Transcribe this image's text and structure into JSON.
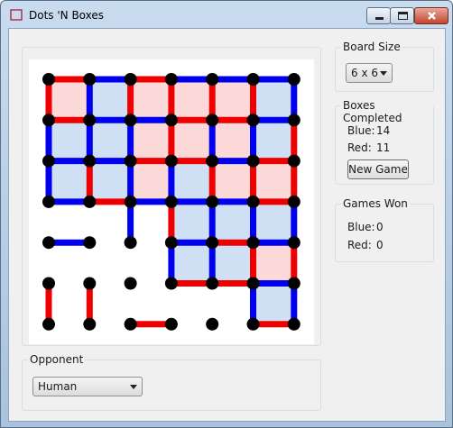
{
  "window": {
    "title": "Dots 'N Boxes"
  },
  "controls": {
    "minimize": "minimize",
    "maximize": "maximize",
    "close": "close"
  },
  "board_size": {
    "legend": "Board Size",
    "value": "6 x 6"
  },
  "boxes_completed": {
    "legend": "Boxes Completed",
    "blue_label": "Blue:",
    "blue_value": "14",
    "red_label": "Red:",
    "red_value": "11",
    "new_game_label": "New Game"
  },
  "games_won": {
    "legend": "Games Won",
    "blue_label": "Blue:",
    "blue_value": "0",
    "red_label": "Red:",
    "red_value": "0"
  },
  "opponent": {
    "legend": "Opponent",
    "value": "Human"
  },
  "colors": {
    "blue": "#0000ee",
    "red": "#ee0000",
    "blue_box": "#cfe0f4",
    "red_box": "#fbd9d9",
    "dot": "#000000"
  },
  "board": {
    "dots_per_side": 7,
    "boxes": [
      [
        "red",
        "blue",
        "red",
        "red",
        "red",
        "blue"
      ],
      [
        "blue",
        "blue",
        "red",
        "red",
        "red",
        "blue"
      ],
      [
        "blue",
        "blue",
        "red",
        "blue",
        "red",
        "red"
      ],
      [
        null,
        null,
        null,
        "blue",
        "blue",
        "blue"
      ],
      [
        null,
        null,
        null,
        "blue",
        "blue",
        "red"
      ],
      [
        null,
        null,
        null,
        null,
        null,
        "blue"
      ]
    ],
    "h_lines": [
      [
        "red",
        "blue",
        "red",
        "blue",
        "blue",
        "blue"
      ],
      [
        "red",
        "blue",
        "blue",
        "red",
        "red",
        "blue"
      ],
      [
        "blue",
        "blue",
        "red",
        "red",
        "blue",
        "red"
      ],
      [
        "blue",
        "red",
        "blue",
        "blue",
        "blue",
        "red"
      ],
      [
        "blue",
        null,
        null,
        "blue",
        "red",
        "blue"
      ],
      [
        null,
        null,
        null,
        "red",
        "red",
        "blue"
      ],
      [
        null,
        null,
        "red",
        null,
        null,
        "red"
      ]
    ],
    "v_lines": [
      [
        "red",
        "blue",
        "red",
        "red",
        "red",
        "red",
        "blue"
      ],
      [
        "blue",
        "blue",
        "blue",
        "red",
        "blue",
        "blue",
        "red"
      ],
      [
        "blue",
        "red",
        "blue",
        "blue",
        "red",
        "red",
        "red"
      ],
      [
        null,
        null,
        "blue",
        "red",
        "blue",
        "blue",
        "blue"
      ],
      [
        null,
        null,
        null,
        "blue",
        "blue",
        "red",
        "red"
      ],
      [
        "red",
        "red",
        null,
        null,
        null,
        "blue",
        "blue"
      ]
    ]
  }
}
